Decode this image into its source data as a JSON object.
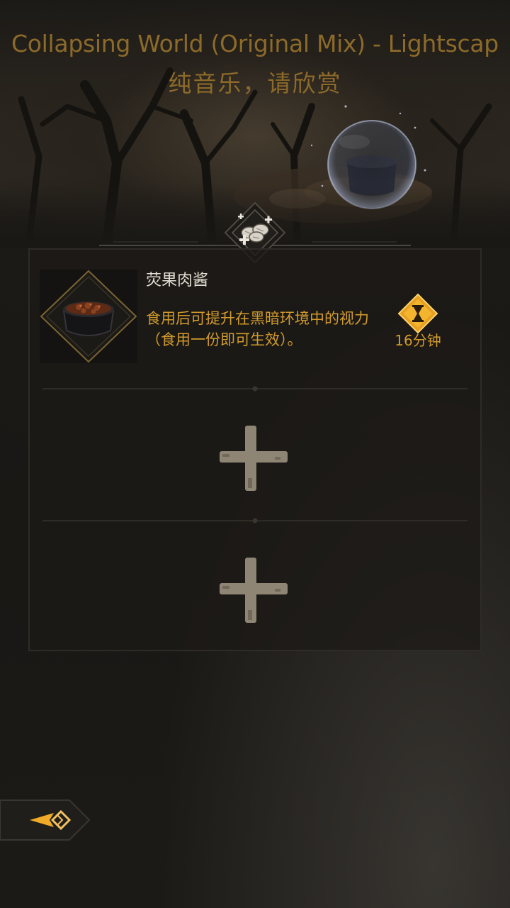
{
  "music": {
    "track_title": "Collapsing World (Original Mix) - Lightscap",
    "subtitle": "纯音乐，请欣赏"
  },
  "category": {
    "icon": "meat-food-icon"
  },
  "food_slots": [
    {
      "name": "荧果肉酱",
      "description": "食用后可提升在黑暗环境中的视力（食用一份即可生效）。",
      "duration_label": "16分钟",
      "icon": "meat-stew-pot-icon",
      "duration_icon": "hourglass-icon"
    }
  ],
  "empty_slots": [
    {
      "icon": "add-plus-icon"
    },
    {
      "icon": "add-plus-icon"
    }
  ],
  "navigation": {
    "back_icon": "back-arrow-icon"
  },
  "colors": {
    "title_gold": "#8c6a2a",
    "accent_gold": "#d19a2c",
    "text_light": "#e2ddd2",
    "plus_beige": "#8f8574",
    "background": "#1a1815"
  }
}
